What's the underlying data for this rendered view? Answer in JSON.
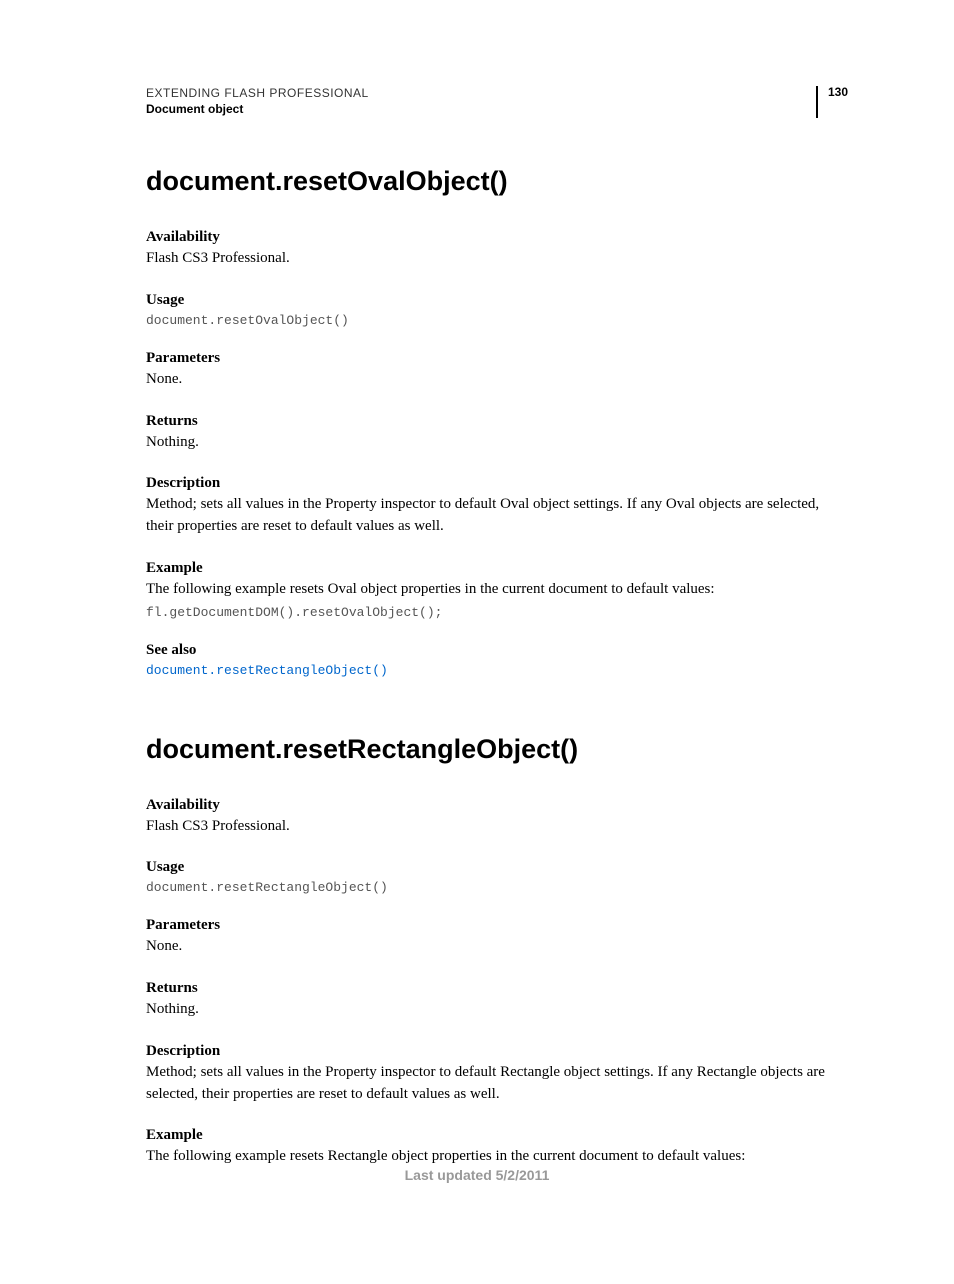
{
  "header": {
    "title": "EXTENDING FLASH PROFESSIONAL",
    "subtitle": "Document object",
    "page_number": "130"
  },
  "entries": [
    {
      "heading": "document.resetOvalObject()",
      "availability_label": "Availability",
      "availability_text": "Flash CS3 Professional.",
      "usage_label": "Usage",
      "usage_code": "document.resetOvalObject()",
      "parameters_label": "Parameters",
      "parameters_text": "None.",
      "returns_label": "Returns",
      "returns_text": "Nothing.",
      "description_label": "Description",
      "description_text": "Method; sets all values in the Property inspector to default Oval object settings. If any Oval objects are selected, their properties are reset to default values as well.",
      "example_label": "Example",
      "example_text": "The following example resets Oval object properties in the current document to default values:",
      "example_code": "fl.getDocumentDOM().resetOvalObject();",
      "seealso_label": "See also",
      "seealso_link": "document.resetRectangleObject()"
    },
    {
      "heading": "document.resetRectangleObject()",
      "availability_label": "Availability",
      "availability_text": "Flash CS3 Professional.",
      "usage_label": "Usage",
      "usage_code": "document.resetRectangleObject()",
      "parameters_label": "Parameters",
      "parameters_text": "None.",
      "returns_label": "Returns",
      "returns_text": "Nothing.",
      "description_label": "Description",
      "description_text": "Method; sets all values in the Property inspector to default Rectangle object settings. If any Rectangle objects are selected, their properties are reset to default values as well.",
      "example_label": "Example",
      "example_text": "The following example resets Rectangle object properties in the current document to default values:"
    }
  ],
  "footer": {
    "last_updated": "Last updated 5/2/2011"
  }
}
